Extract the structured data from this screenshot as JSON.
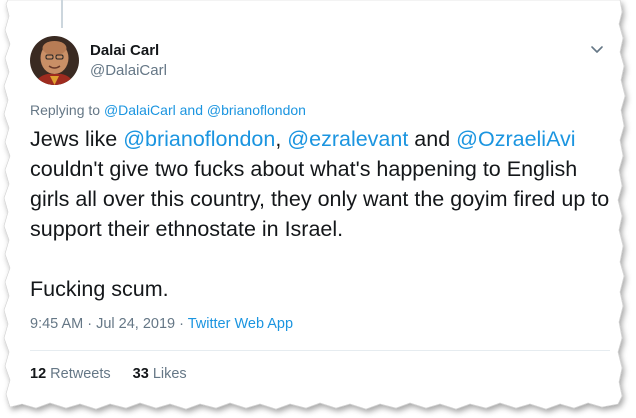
{
  "user": {
    "display_name": "Dalai Carl",
    "handle": "@DalaiCarl"
  },
  "reply_context": {
    "prefix": "Replying to ",
    "targets": [
      "@DalaiCarl",
      "@brianoflondon"
    ],
    "joiner": " and "
  },
  "tweet": {
    "line1_pre": "Jews like ",
    "mention1": "@brianoflondon",
    "comma": ", ",
    "mention2": "@ezralevant",
    "and_text": " and ",
    "mention3": "@OzraeliAvi",
    "body_rest": "couldn't give two fucks about what's happening to English girls all over this country, they only want the goyim fired up to support their ethnostate in Israel.",
    "closing": "Fucking scum."
  },
  "meta": {
    "time": "9:45 AM",
    "separator1": " · ",
    "date": "Jul 24, 2019",
    "separator2": " · ",
    "source": "Twitter Web App"
  },
  "stats": {
    "retweets_count": "12",
    "retweets_label": "Retweets",
    "likes_count": "33",
    "likes_label": "Likes"
  },
  "icons": {
    "caret": "chevron-down-icon"
  },
  "colors": {
    "link": "#1b95e0",
    "text": "#14171a",
    "secondary": "#657786"
  }
}
